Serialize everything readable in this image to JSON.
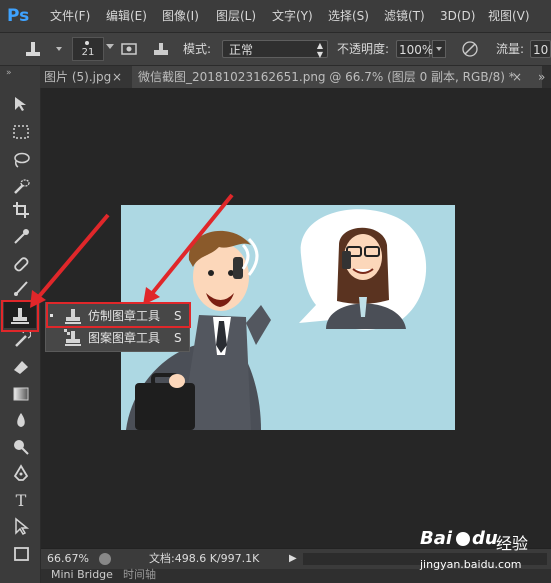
{
  "app": {
    "logo": "Ps"
  },
  "menu": [
    "文件(F)",
    "编辑(E)",
    "图像(I)",
    "图层(L)",
    "文字(Y)",
    "选择(S)",
    "滤镜(T)",
    "3D(D)",
    "视图(V)"
  ],
  "options": {
    "brush_size": "21",
    "mode_label": "模式:",
    "mode_value": "正常",
    "opacity_label": "不透明度:",
    "opacity_value": "100%",
    "flow_label": "流量:",
    "flow_value": "10"
  },
  "tabs": [
    {
      "label": "图片 (5).jpg",
      "close": "×"
    },
    {
      "label": "微信截图_20181023162651.png @ 66.7% (图层 0 副本, RGB/8) *",
      "close": "×"
    }
  ],
  "tabbar_overflow": "»",
  "toolpanel_grip": "»",
  "flyout": {
    "items": [
      {
        "label": "仿制图章工具",
        "shortcut": "S"
      },
      {
        "label": "图案图章工具",
        "shortcut": "S"
      }
    ]
  },
  "status": {
    "zoom": "66.67%",
    "doc": "文档:498.6 K/997.1K",
    "arrow": "▶"
  },
  "bottom_tabs": [
    "Mini Bridge",
    "时间轴"
  ],
  "watermark": {
    "brand": "Bai",
    "brand2": "du",
    "text": "经验",
    "url": "jingyan.baidu.com"
  },
  "colors": {
    "accent": "#3fa3ff",
    "highlight": "#e0272a",
    "canvas_bg": "#add8e3"
  }
}
